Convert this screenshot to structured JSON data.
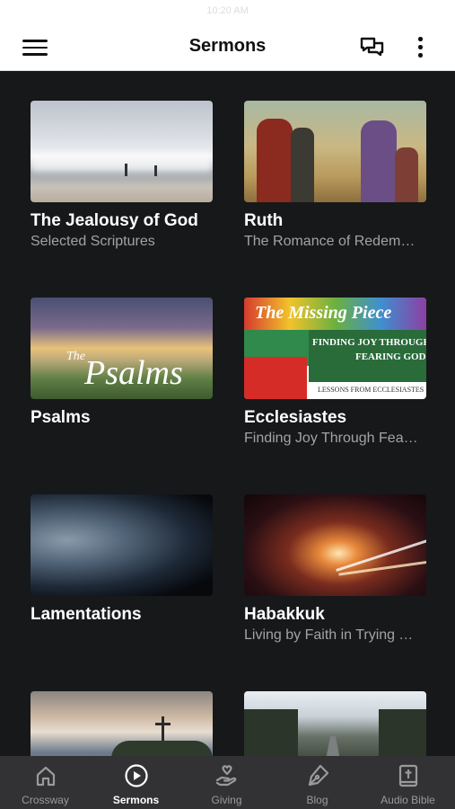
{
  "status_bar": {
    "time": "10:20 AM"
  },
  "app_bar": {
    "title": "Sermons"
  },
  "sermons": [
    {
      "title": "The Jealousy of God",
      "subtitle": "Selected Scriptures"
    },
    {
      "title": "Ruth",
      "subtitle": "The Romance of Redemption"
    },
    {
      "title": "Psalms",
      "subtitle": "",
      "thumb_text": {
        "small": "The",
        "big": "Psalms"
      }
    },
    {
      "title": "Ecclesiastes",
      "subtitle": "Finding Joy Through Fearing God",
      "thumb_text": {
        "line1": "The Missing Piece",
        "line2": "FINDING JOY THROUGH",
        "line3": "FEARING GOD",
        "line4": "LESSONS FROM ECCLESIASTES"
      }
    },
    {
      "title": "Lamentations",
      "subtitle": ""
    },
    {
      "title": "Habakkuk",
      "subtitle": "Living by Faith in Trying Times"
    },
    {
      "title": "",
      "subtitle": ""
    },
    {
      "title": "",
      "subtitle": ""
    }
  ],
  "tabs": [
    {
      "label": "Crossway",
      "icon": "home-icon"
    },
    {
      "label": "Sermons",
      "icon": "play-circle-icon",
      "active": true
    },
    {
      "label": "Giving",
      "icon": "giving-hand-icon"
    },
    {
      "label": "Blog",
      "icon": "pen-icon"
    },
    {
      "label": "Audio Bible",
      "icon": "bible-icon"
    }
  ],
  "colors": {
    "background": "#17181a",
    "tab_bar": "#323234",
    "subtitle": "#a3a3a3",
    "app_bar": "#ffffff"
  }
}
